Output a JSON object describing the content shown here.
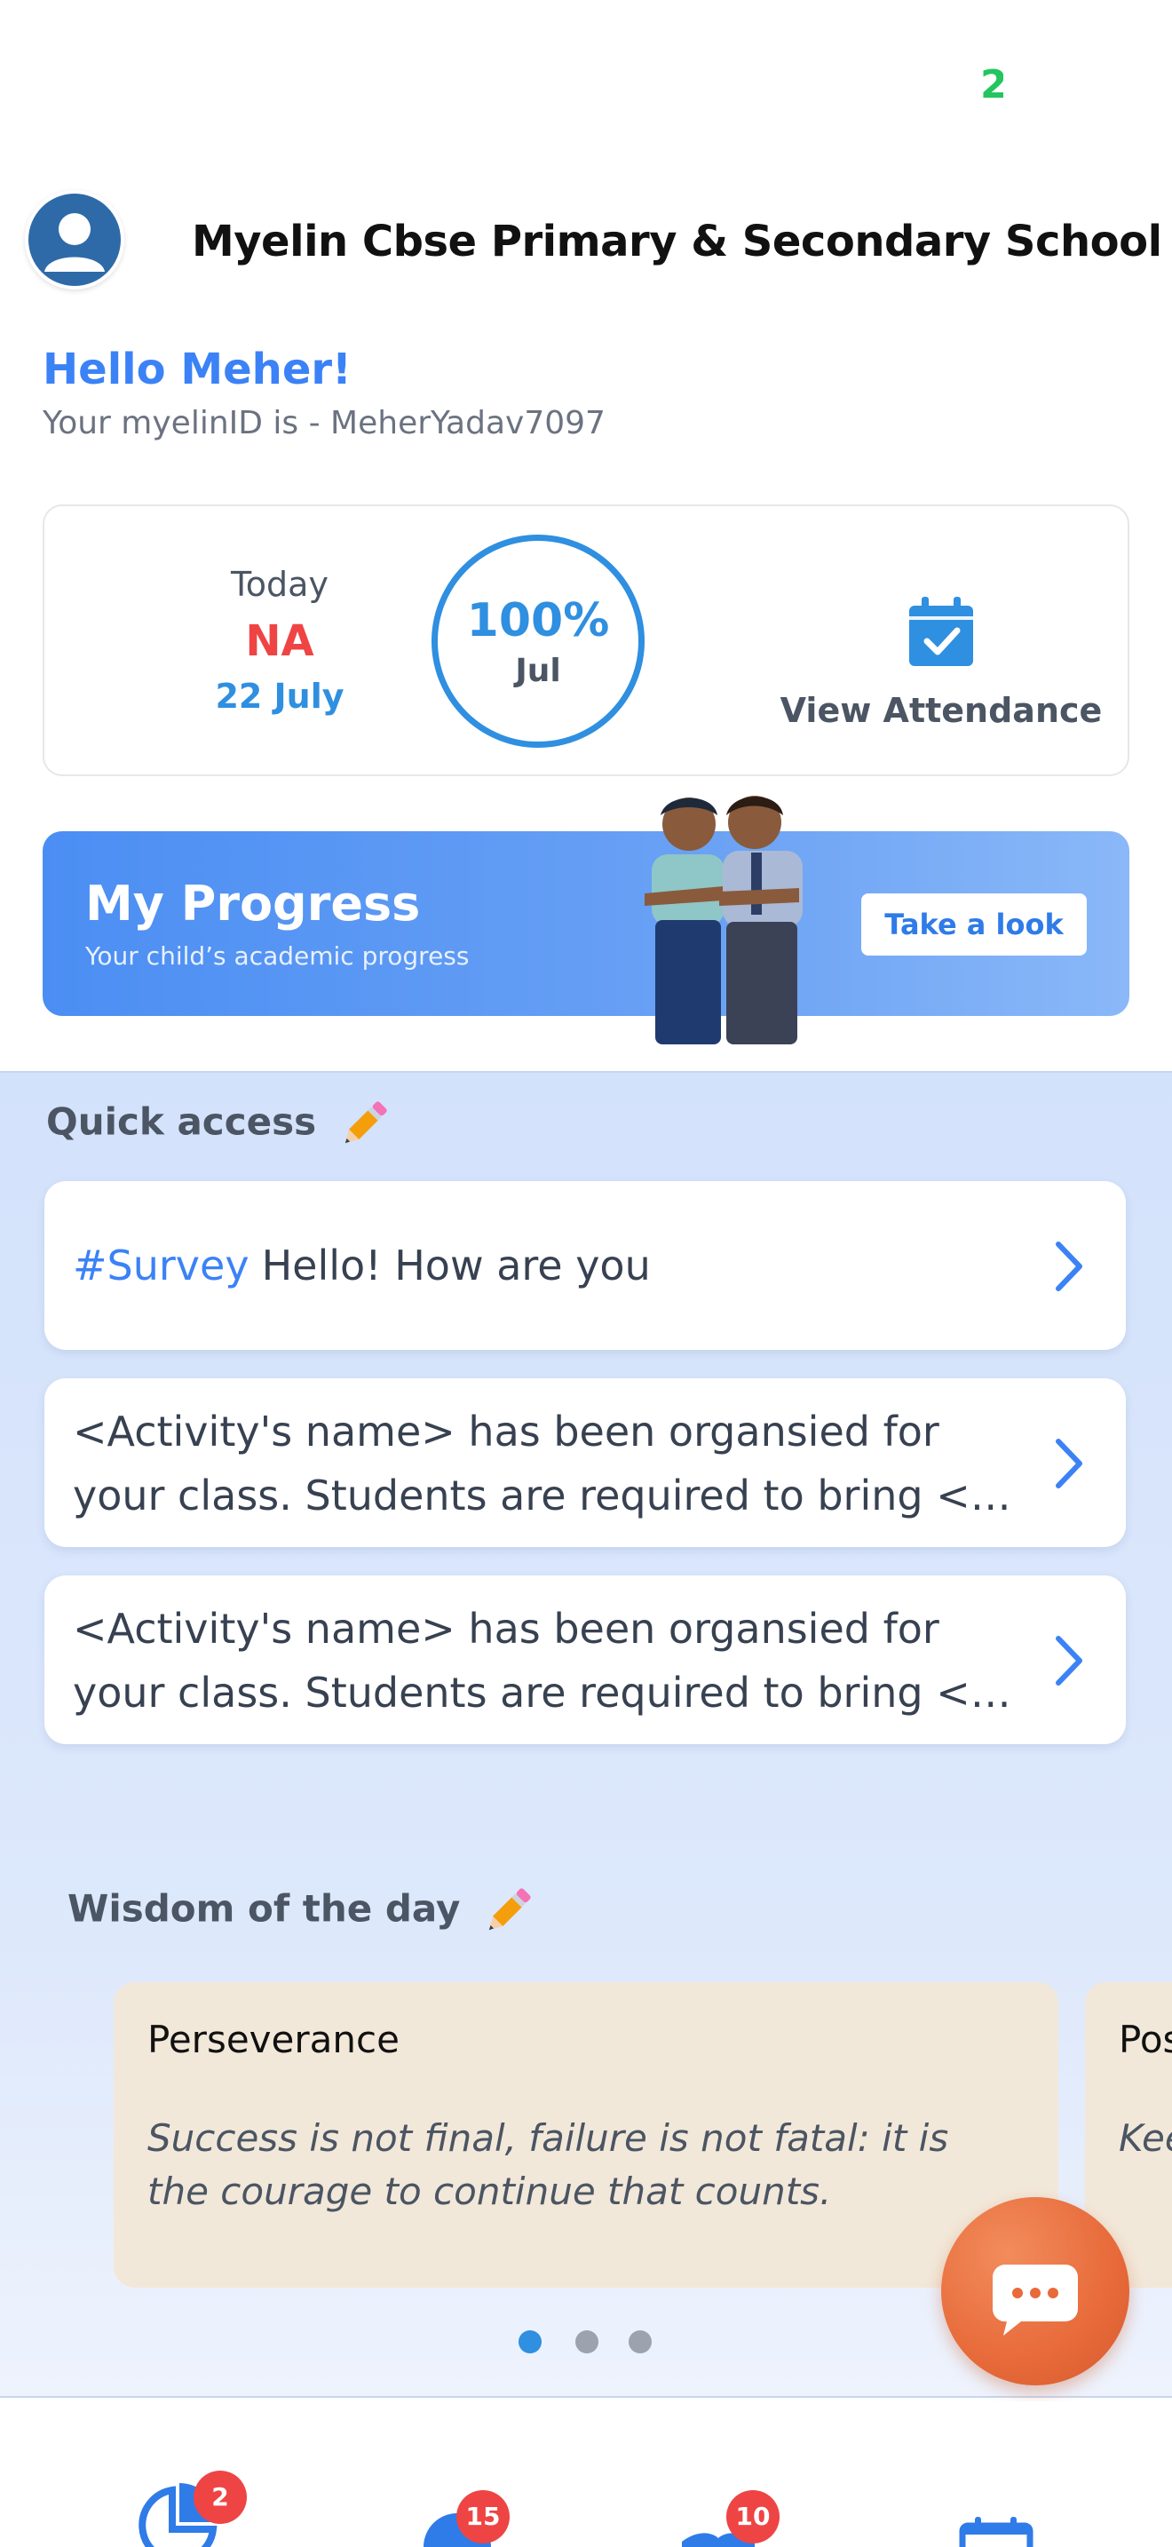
{
  "status": {
    "badge_text": "2"
  },
  "header": {
    "school_name": "Myelin Cbse Primary & Secondary School",
    "avatar_icon": "user-avatar-icon"
  },
  "greeting": {
    "title": "Hello Meher!",
    "myelin_id_text": "Your myelinID is - MeherYadav7097"
  },
  "attendance": {
    "today_label": "Today",
    "today_status": "NA",
    "today_date": "22 July",
    "percent": "100%",
    "month": "Jul",
    "view_label": "View Attendance",
    "icon": "calendar-check-icon"
  },
  "progress": {
    "title": "My Progress",
    "subtitle": "Your child’s academic progress",
    "button": "Take a look"
  },
  "quick_access": {
    "title": "Quick access",
    "items": [
      {
        "tag": "#Survey",
        "line1": "Hello! How are you",
        "line2": ""
      },
      {
        "tag": "",
        "line1": " <Activity's name> has been organsied for",
        "line2": "your class. Students are required to bring <…"
      },
      {
        "tag": "",
        "line1": " <Activity's name> has been organsied for",
        "line2": "your class. Students are required to bring <…"
      }
    ]
  },
  "wisdom": {
    "title": "Wisdom of the day",
    "cards": [
      {
        "title": "Perseverance",
        "quote": "Success is not final, failure is not fatal: it is the courage to continue that counts."
      },
      {
        "title": "Pos",
        "quote": "Kee and"
      }
    ],
    "page_count": 3,
    "active_page": 1
  },
  "bottom_nav": {
    "items": [
      {
        "icon": "pie-chart-icon",
        "badge": "2"
      },
      {
        "icon": "person-icon",
        "badge": "15"
      },
      {
        "icon": "book-icon",
        "badge": "10"
      },
      {
        "icon": "calendar-icon",
        "badge": ""
      }
    ]
  },
  "colors": {
    "accent": "#3b82f6",
    "danger": "#ef4444",
    "fab": "#e86a3a",
    "wisdom_card": "#f2e8d9"
  }
}
